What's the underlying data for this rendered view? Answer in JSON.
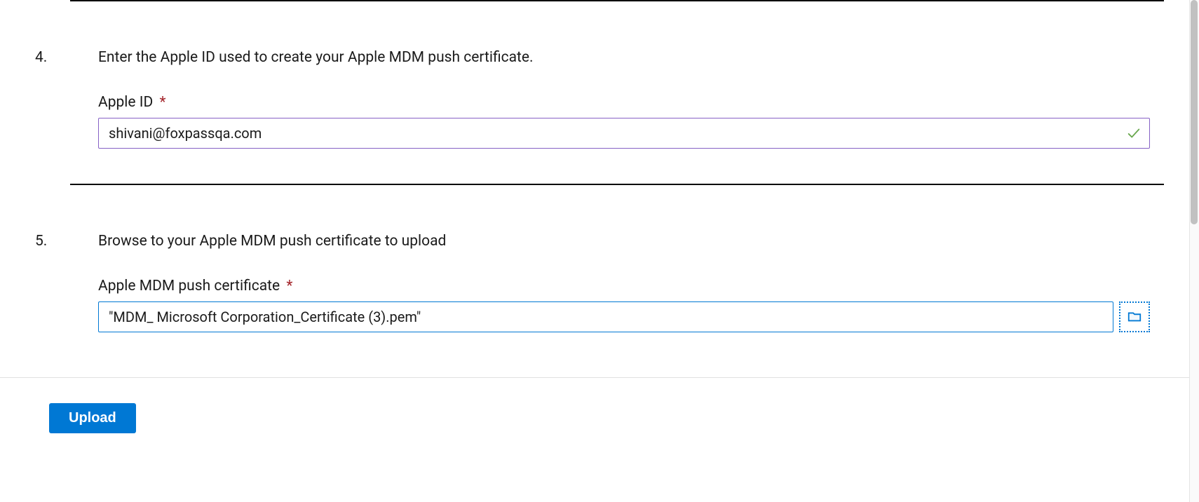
{
  "steps": {
    "s4": {
      "number": "4.",
      "instruction": "Enter the Apple ID used to create your Apple MDM push certificate.",
      "field_label": "Apple ID",
      "required_marker": "*",
      "value": "shivani@foxpassqa.com"
    },
    "s5": {
      "number": "5.",
      "instruction": "Browse to your Apple MDM push certificate to upload",
      "field_label": "Apple MDM push certificate",
      "required_marker": "*",
      "value": "\"MDM_ Microsoft Corporation_Certificate (3).pem\""
    }
  },
  "footer": {
    "upload_label": "Upload"
  }
}
